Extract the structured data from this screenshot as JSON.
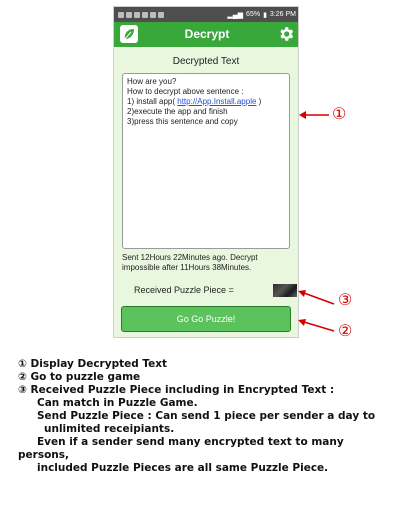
{
  "statusbar": {
    "battery": "65%",
    "time": "3:26 PM"
  },
  "appbar": {
    "title": "Decrypt",
    "logo_icon": "leaf-icon",
    "settings_icon": "gear-icon"
  },
  "section": {
    "title": "Decrypted Text"
  },
  "decrypted": {
    "line1": "How are you?",
    "line2": "How to decrypt above sentence :",
    "line3_prefix": "1) install app( ",
    "line3_link": "http://App.Install.apple",
    "line3_suffix": " )",
    "line4": "2)execute the app and finish",
    "line5": "3)press this sentence and copy"
  },
  "sent_info": "Sent 12Hours 22Minutes ago. Decrypt impossible after 11Hours 38Minutes.",
  "puzzle": {
    "label": "Received Puzzle Piece ="
  },
  "go_button": "Go Go Puzzle!",
  "callouts": {
    "c1": "①",
    "c2": "②",
    "c3": "③"
  },
  "colors": {
    "appbar": "#38a83a",
    "background": "#e9f7df",
    "button": "#5cc25c",
    "callout": "#d40000"
  },
  "legend": {
    "l1": "① Display Decrypted Text",
    "l2": "② Go to puzzle game",
    "l3": "③ Received Puzzle Piece including in Encrypted Text :",
    "l4": "Can match in Puzzle Game.",
    "l5": "Send Puzzle Piece : Can send 1 piece per sender a day to",
    "l6": "unlimited receipiants.",
    "l7": "Even if a sender send many encrypted text to many",
    "l8": "persons,",
    "l9": "included Puzzle Pieces are all same Puzzle Piece."
  }
}
